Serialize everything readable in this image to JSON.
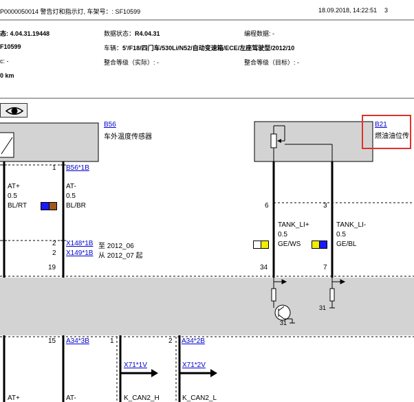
{
  "header": {
    "doc_title": "P0000050014 警告灯和指示灯, 车架号：: SF10599",
    "datetime": "18.09.2018, 14:22:51",
    "page": "3"
  },
  "info": {
    "row1_a": "态: 4.04.31.19448",
    "row1_b_label": "数据状态：",
    "row1_b_value": "R4.04.31",
    "row1_c": "编程数据: -",
    "row2_a": "F10599",
    "row2_b_label": "车辆：",
    "row2_b_value": "5'/F18/四门车/530Li/N52/自动变速箱/ECE/左座驾驶型/2012/10",
    "row3_a": "c: -",
    "row3_b": "整合等级（实际）: -",
    "row3_c": "整合等级（目标）: -",
    "row4_a": "0 km"
  },
  "toolbar": {
    "eye_icon": "eye-icon"
  },
  "diagram": {
    "b56_link": "B56",
    "b56_name": "车外温度传感器",
    "b21_link": "B21",
    "b21_name": "燃油油位传",
    "pin_b56_1": "1",
    "b56_pin_link": "B56*1B",
    "w1_name": "AT+",
    "w1_size": "0.5",
    "w1_color": "BL/RT",
    "w2_name": "AT-",
    "w2_size": "0.5",
    "w2_color": "BL/BR",
    "pin_x148": "2",
    "x148_link": "X148*1B",
    "x148_note": "至 2012_06",
    "pin_x149": "2",
    "x149_link": "X149*1B",
    "x149_note": "从 2012_07 起",
    "pin_19": "19",
    "pin_6": "6",
    "pin_3": "3",
    "w3_name": "TANK_LI+",
    "w3_size": "0.5",
    "w3_color": "GE/WS",
    "w4_name": "TANK_LI-",
    "w4_size": "0.5",
    "w4_color": "GE/BL",
    "pin_34": "34",
    "pin_7": "7",
    "gnd_31a": "31",
    "gnd_31b": "31",
    "pin_15": "15",
    "a34_3b_link": "A34*3B",
    "pin_1b": "1",
    "pin_2b": "2",
    "a34_2b_link": "A34*2B",
    "x71_1v_link": "X71*1V",
    "x71_2v_link": "X71*2V",
    "w5_name": "AT+",
    "w6_name": "AT-",
    "w7_name": "K_CAN2_H",
    "w8_name": "K_CAN2_L"
  },
  "colors": {
    "blue": "#1a1aff",
    "brown": "#9b5a1e",
    "yellow": "#f2ee00",
    "white": "#ffffff",
    "gray_box": "#d3d3d3",
    "highlight": "#e0302a"
  }
}
